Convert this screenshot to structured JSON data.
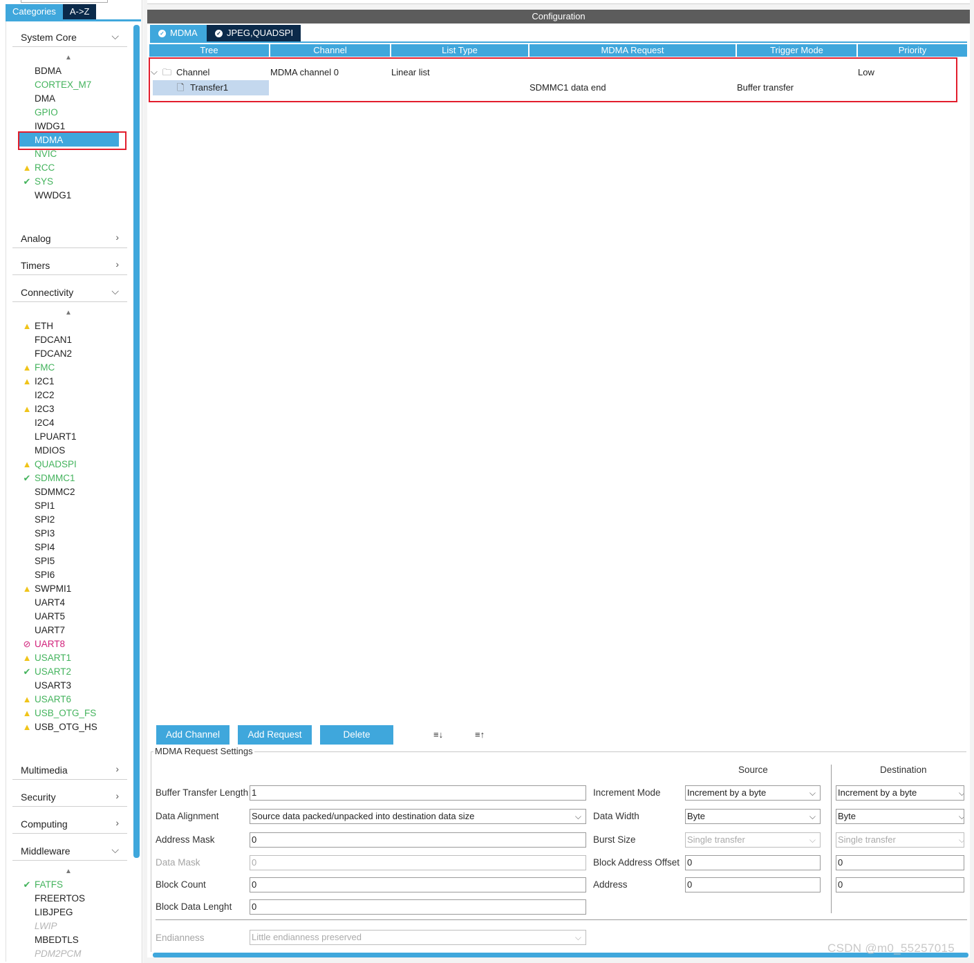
{
  "left": {
    "tabs": [
      "Categories",
      "A->Z"
    ],
    "sections": [
      {
        "label": "System Core",
        "chevron": "⌵"
      },
      {
        "label": "Analog",
        "chevron": "›"
      },
      {
        "label": "Timers",
        "chevron": "›"
      },
      {
        "label": "Connectivity",
        "chevron": "⌵"
      },
      {
        "label": "Multimedia",
        "chevron": "›"
      },
      {
        "label": "Security",
        "chevron": "›"
      },
      {
        "label": "Computing",
        "chevron": "›"
      },
      {
        "label": "Middleware",
        "chevron": "⌵"
      }
    ],
    "system_core": [
      {
        "name": "BDMA",
        "status": "none",
        "color": "black"
      },
      {
        "name": "CORTEX_M7",
        "status": "none",
        "color": "green"
      },
      {
        "name": "DMA",
        "status": "none",
        "color": "black"
      },
      {
        "name": "GPIO",
        "status": "none",
        "color": "green"
      },
      {
        "name": "IWDG1",
        "status": "none",
        "color": "black"
      },
      {
        "name": "MDMA",
        "status": "selected",
        "color": "white"
      },
      {
        "name": "NVIC",
        "status": "none",
        "color": "green"
      },
      {
        "name": "RCC",
        "status": "warn",
        "color": "green"
      },
      {
        "name": "SYS",
        "status": "ok",
        "color": "green"
      },
      {
        "name": "WWDG1",
        "status": "none",
        "color": "black"
      }
    ],
    "connectivity": [
      {
        "name": "ETH",
        "status": "warn",
        "color": "black"
      },
      {
        "name": "FDCAN1",
        "status": "none",
        "color": "black"
      },
      {
        "name": "FDCAN2",
        "status": "none",
        "color": "black"
      },
      {
        "name": "FMC",
        "status": "warn",
        "color": "green"
      },
      {
        "name": "I2C1",
        "status": "warn",
        "color": "black"
      },
      {
        "name": "I2C2",
        "status": "none",
        "color": "black"
      },
      {
        "name": "I2C3",
        "status": "warn",
        "color": "black"
      },
      {
        "name": "I2C4",
        "status": "none",
        "color": "black"
      },
      {
        "name": "LPUART1",
        "status": "none",
        "color": "black"
      },
      {
        "name": "MDIOS",
        "status": "none",
        "color": "black"
      },
      {
        "name": "QUADSPI",
        "status": "warn",
        "color": "green"
      },
      {
        "name": "SDMMC1",
        "status": "ok",
        "color": "green"
      },
      {
        "name": "SDMMC2",
        "status": "none",
        "color": "black"
      },
      {
        "name": "SPI1",
        "status": "none",
        "color": "black"
      },
      {
        "name": "SPI2",
        "status": "none",
        "color": "black"
      },
      {
        "name": "SPI3",
        "status": "none",
        "color": "black"
      },
      {
        "name": "SPI4",
        "status": "none",
        "color": "black"
      },
      {
        "name": "SPI5",
        "status": "none",
        "color": "black"
      },
      {
        "name": "SPI6",
        "status": "none",
        "color": "black"
      },
      {
        "name": "SWPMI1",
        "status": "warn",
        "color": "black"
      },
      {
        "name": "UART4",
        "status": "none",
        "color": "black"
      },
      {
        "name": "UART5",
        "status": "none",
        "color": "black"
      },
      {
        "name": "UART7",
        "status": "none",
        "color": "black"
      },
      {
        "name": "UART8",
        "status": "ban",
        "color": "pink"
      },
      {
        "name": "USART1",
        "status": "warn",
        "color": "green"
      },
      {
        "name": "USART2",
        "status": "ok",
        "color": "green"
      },
      {
        "name": "USART3",
        "status": "none",
        "color": "black"
      },
      {
        "name": "USART6",
        "status": "warn",
        "color": "green"
      },
      {
        "name": "USB_OTG_FS",
        "status": "warn",
        "color": "green"
      },
      {
        "name": "USB_OTG_HS",
        "status": "warn",
        "color": "black"
      }
    ],
    "middleware": [
      {
        "name": "FATFS",
        "status": "ok",
        "color": "green"
      },
      {
        "name": "FREERTOS",
        "status": "none",
        "color": "black"
      },
      {
        "name": "LIBJPEG",
        "status": "none",
        "color": "black"
      },
      {
        "name": "LWIP",
        "status": "none",
        "color": "gray"
      },
      {
        "name": "MBEDTLS",
        "status": "none",
        "color": "black"
      },
      {
        "name": "PDM2PCM",
        "status": "none",
        "color": "gray"
      }
    ]
  },
  "config": {
    "title": "Configuration",
    "tabs": [
      "MDMA",
      "JPEG,QUADSPI"
    ],
    "columns": [
      "Tree",
      "Channel",
      "List Type",
      "MDMA Request",
      "Trigger Mode",
      "Priority"
    ],
    "channel_row": {
      "tree": "Channel",
      "channel": "MDMA channel 0",
      "list_type": "Linear list",
      "priority": "Low"
    },
    "transfer_row": {
      "tree": "Transfer1",
      "request": "SDMMC1 data end",
      "trigger": "Buffer transfer"
    },
    "buttons": {
      "add_channel": "Add Channel",
      "add_request": "Add Request",
      "delete": "Delete"
    },
    "settings": {
      "legend": "MDMA Request Settings",
      "source_header": "Source",
      "dest_header": "Destination",
      "buffer_transfer_length": {
        "label": "Buffer Transfer Length",
        "value": "1"
      },
      "data_alignment": {
        "label": "Data Alignment",
        "value": "Source data packed/unpacked into destination data size"
      },
      "address_mask": {
        "label": "Address Mask",
        "value": "0"
      },
      "data_mask": {
        "label": "Data Mask",
        "value": "0"
      },
      "block_count": {
        "label": "Block Count",
        "value": "0"
      },
      "block_data_length": {
        "label": "Block Data Lenght",
        "value": "0"
      },
      "endianness": {
        "label": "Endianness",
        "value": "Little endianness preserved"
      },
      "increment_mode": {
        "label": "Increment Mode",
        "source": "Increment by a byte",
        "dest": "Increment by a byte"
      },
      "data_width": {
        "label": "Data Width",
        "source": "Byte",
        "dest": "Byte"
      },
      "burst_size": {
        "label": "Burst Size",
        "source": "Single transfer",
        "dest": "Single transfer"
      },
      "block_address_offset": {
        "label": "Block Address Offset",
        "source": "0",
        "dest": "0"
      },
      "address": {
        "label": "Address",
        "source": "0",
        "dest": "0"
      }
    }
  },
  "watermark": "CSDN @m0_55257015",
  "colors": {
    "accent": "#3fa7dc",
    "dark_tab": "#0b2a4a",
    "highlight": "#e21d2c",
    "ok_green": "#43b35c",
    "warn": "#f0c419"
  }
}
